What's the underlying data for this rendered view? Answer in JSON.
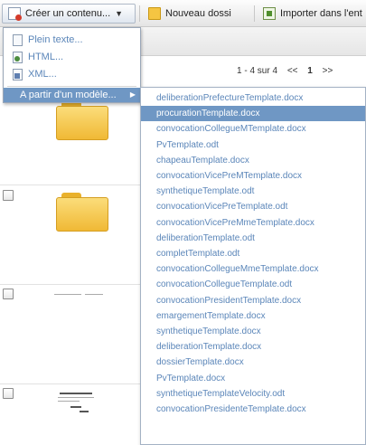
{
  "toolbar": {
    "create_label": "Créer un contenu...",
    "new_folder_label": "Nouveau dossier",
    "import_label": "Importer dans l'ent"
  },
  "create_menu": {
    "items": [
      {
        "label": "Plein texte...",
        "icon": "text-document-icon"
      },
      {
        "label": "HTML...",
        "icon": "html-document-icon"
      },
      {
        "label": "XML...",
        "icon": "xml-document-icon"
      }
    ],
    "submenu_label": "A partir d'un modèle..."
  },
  "pager": {
    "range": "1 - 4 sur 4",
    "prev": "<<",
    "page": "1",
    "next": ">>"
  },
  "templates": [
    "deliberationPrefectureTemplate.docx",
    "procurationTemplate.docx",
    "convocationCollegueMTemplate.docx",
    "PvTemplate.odt",
    "chapeauTemplate.docx",
    "convocationVicePreMTemplate.docx",
    "synthetiqueTemplate.odt",
    "convocationVicePreTemplate.odt",
    "convocationVicePreMmeTemplate.docx",
    "deliberationTemplate.odt",
    "completTemplate.odt",
    "convocationCollegueMmeTemplate.docx",
    "convocationCollegueTemplate.odt",
    "convocationPresidentTemplate.docx",
    "emargementTemplate.docx",
    "synthetiqueTemplate.docx",
    "deliberationTemplate.docx",
    "dossierTemplate.docx",
    "PvTemplate.docx",
    "synthetiqueTemplateVelocity.odt",
    "convocationPresidenteTemplate.docx"
  ],
  "selected_template_index": 1,
  "colors": {
    "link": "#5b86b9",
    "highlight": "#6f97c4"
  }
}
